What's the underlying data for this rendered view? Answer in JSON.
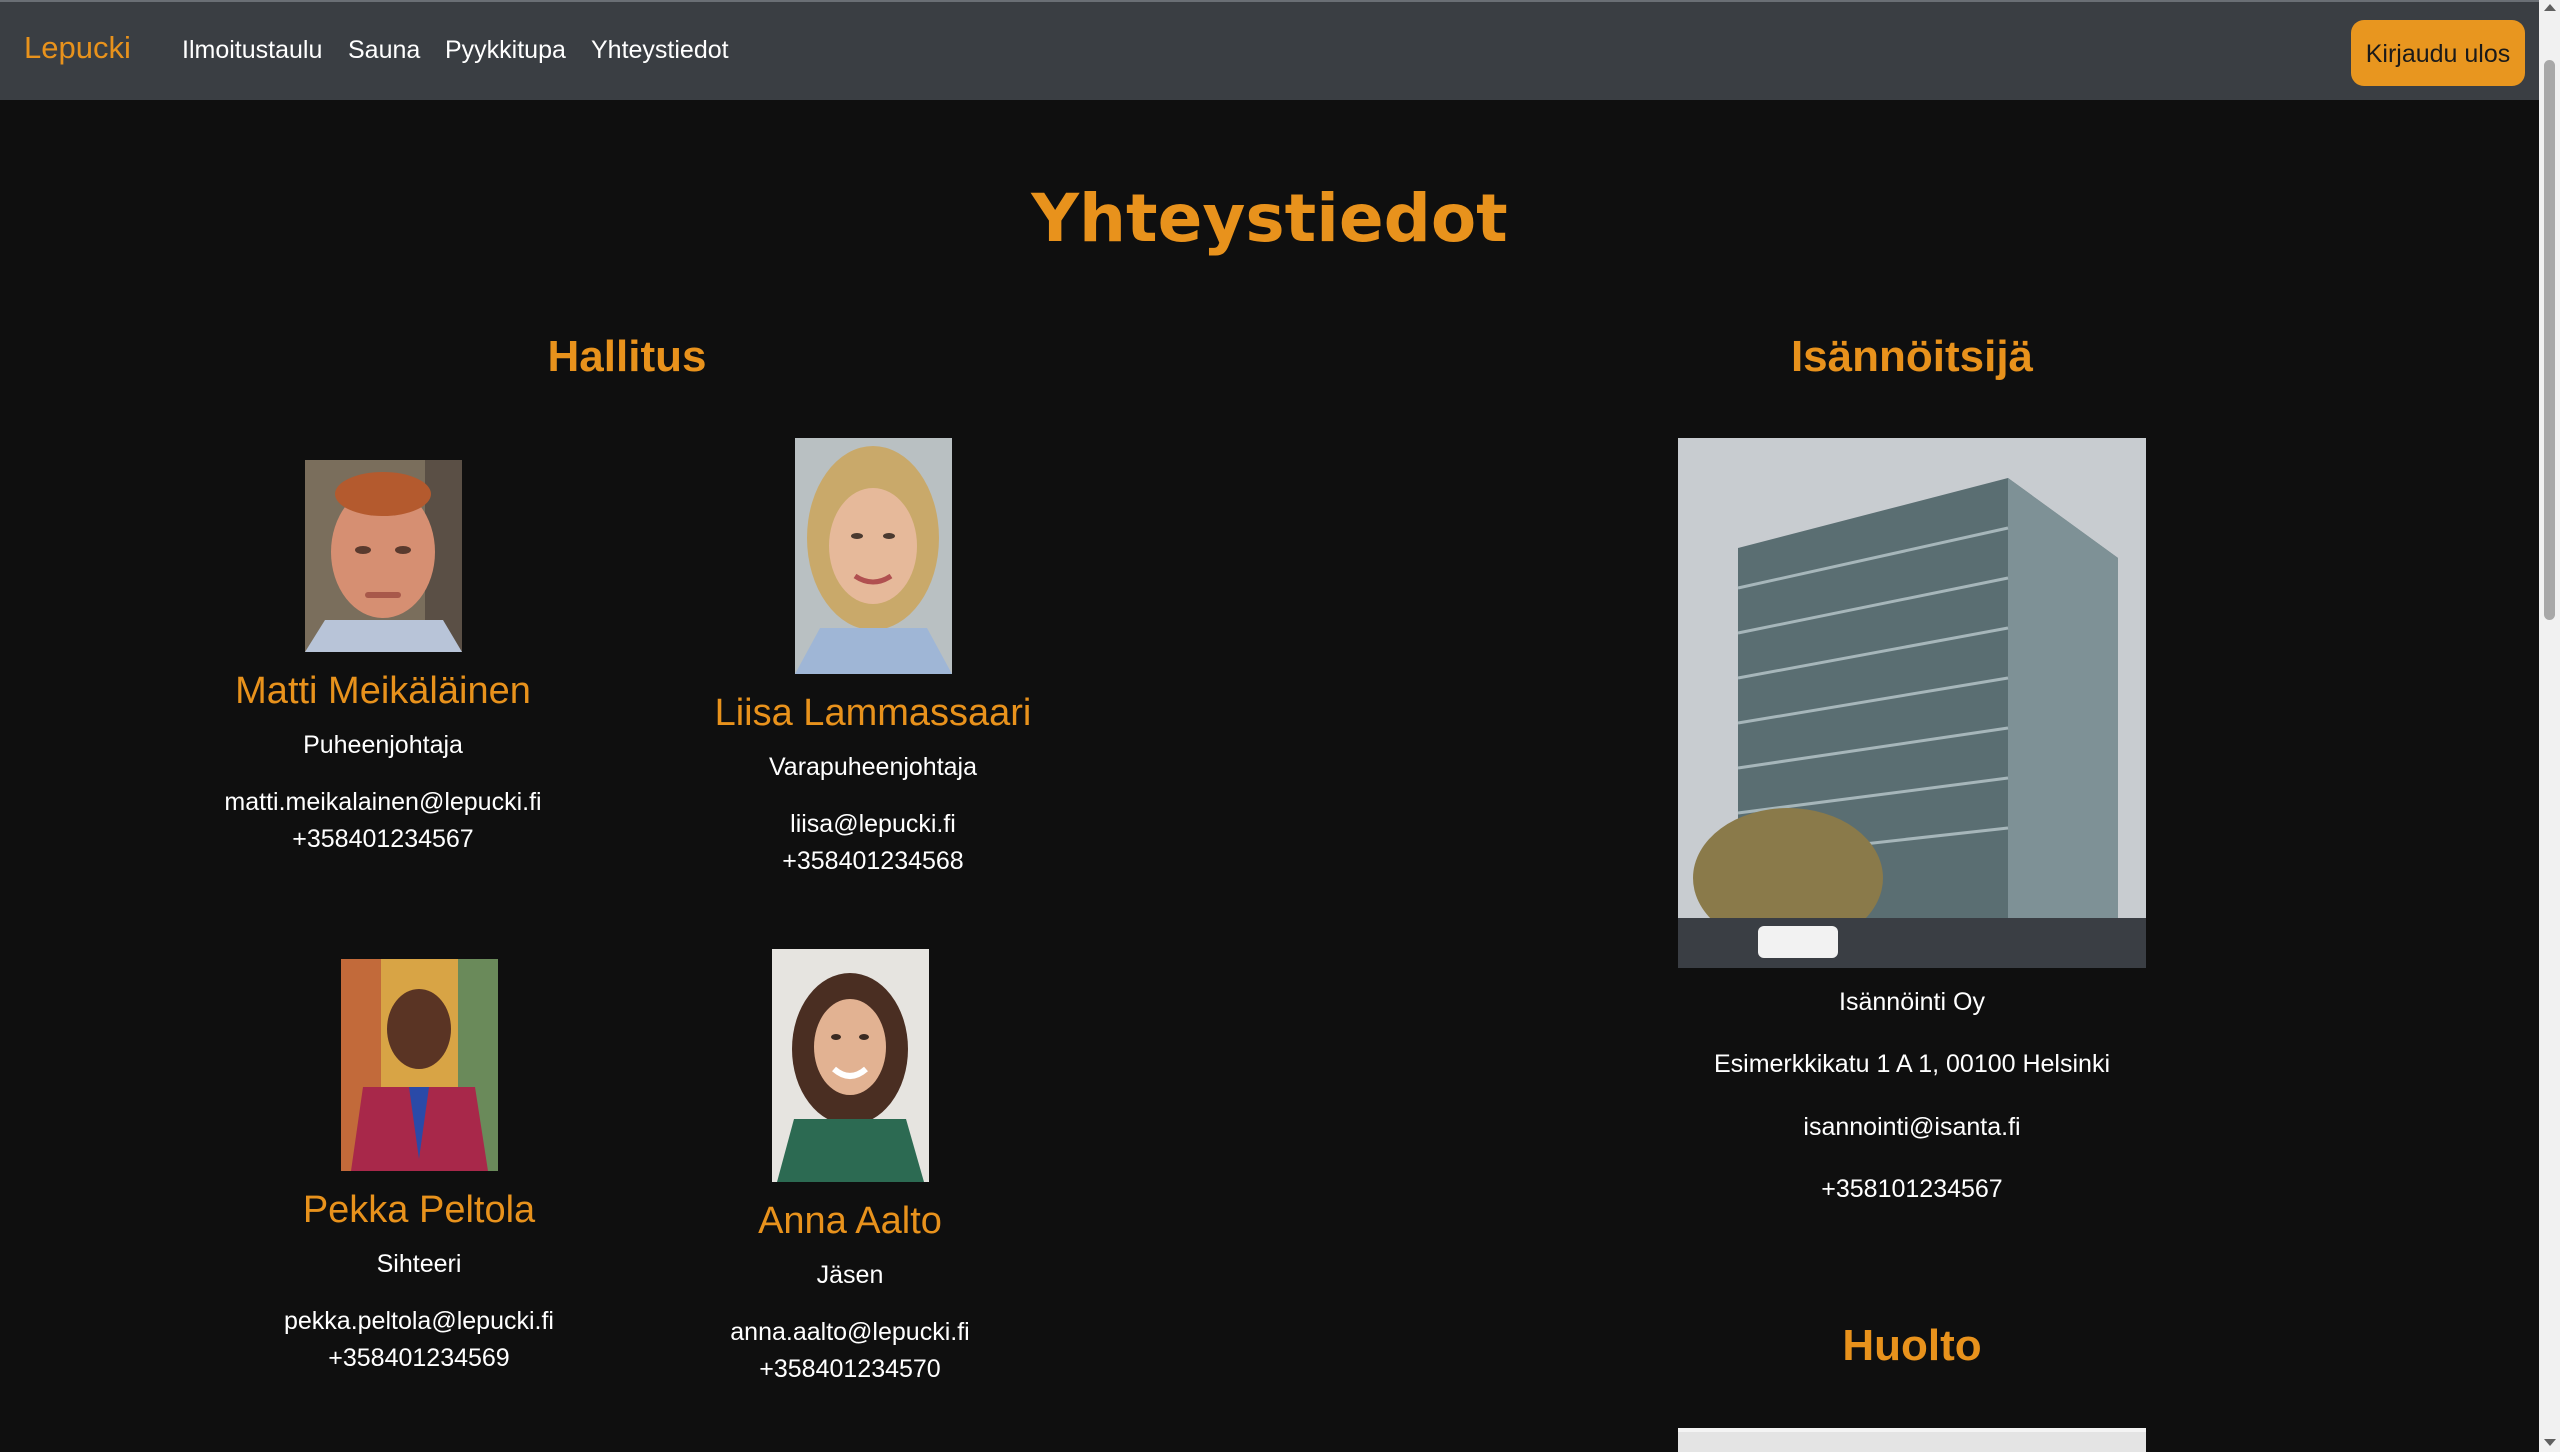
{
  "nav": {
    "brand": "Lepucki",
    "links": [
      "Ilmoitustaulu",
      "Sauna",
      "Pyykkitupa",
      "Yhteystiedot"
    ],
    "logout_label": "Kirjaudu ulos"
  },
  "page": {
    "title": "Yhteystiedot"
  },
  "board": {
    "title": "Hallitus",
    "members": [
      {
        "name": "Matti Meikäläinen",
        "role": "Puheenjohtaja",
        "email": "matti.meikalainen@lepucki.fi",
        "phone": "+358401234567"
      },
      {
        "name": "Liisa Lammassaari",
        "role": "Varapuheenjohtaja",
        "email": "liisa@lepucki.fi",
        "phone": "+358401234568"
      },
      {
        "name": "Pekka Peltola",
        "role": "Sihteeri",
        "email": "pekka.peltola@lepucki.fi",
        "phone": "+358401234569"
      },
      {
        "name": "Anna Aalto",
        "role": "Jäsen",
        "email": "anna.aalto@lepucki.fi",
        "phone": "+358401234570"
      }
    ]
  },
  "manager": {
    "title": "Isännöitsijä",
    "company": "Isännöinti Oy",
    "address": "Esimerkkikatu 1 A 1, 00100 Helsinki",
    "email": "isannointi@isanta.fi",
    "phone": "+358101234567"
  },
  "maintenance": {
    "title": "Huolto"
  },
  "colors": {
    "accent": "#e8921c",
    "navbar": "#3a3e43",
    "background": "#0f0f0f"
  }
}
